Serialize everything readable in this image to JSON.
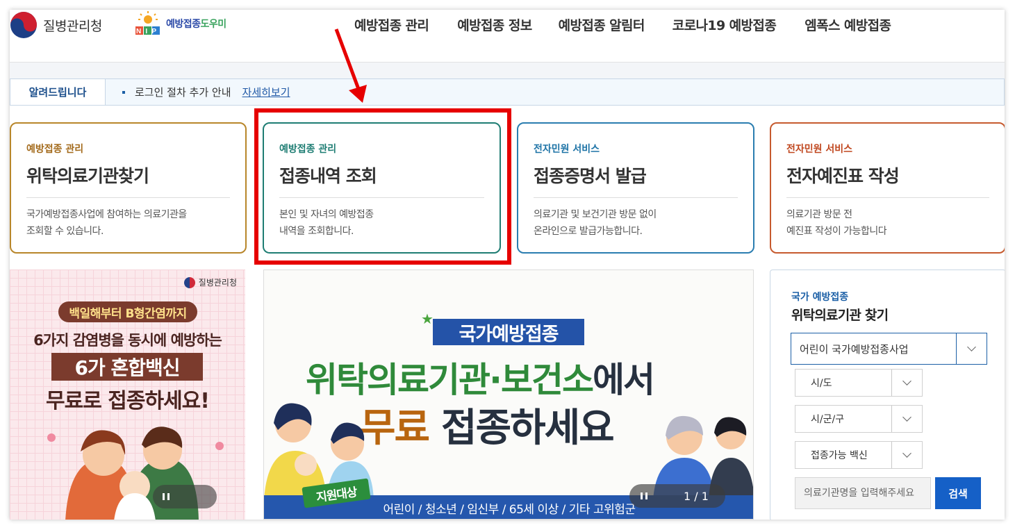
{
  "header": {
    "org_name": "질병관리청",
    "nip_name_part1": "예방접종",
    "nip_name_part2": "도우미",
    "nip_letters": "NIP",
    "nav": [
      "예방접종 관리",
      "예방접종 정보",
      "예방접종 알림터",
      "코로나19 예방접종",
      "엠폭스 예방접종"
    ]
  },
  "notice": {
    "label": "알려드립니다",
    "text": "로그인 절차 추가 안내",
    "link": "자세히보기"
  },
  "cards": [
    {
      "category": "예방접종 관리",
      "title": "위탁의료기관찾기",
      "desc": "국가예방접종사업에 참여하는 의료기관을\n조회할 수 있습니다."
    },
    {
      "category": "예방접종 관리",
      "title": "접종내역 조회",
      "desc": "본인 및 자녀의 예방접종\n내역을 조회합니다."
    },
    {
      "category": "전자민원 서비스",
      "title": "접종증명서 발급",
      "desc": "의료기관 및 보건기관 방문 없이\n온라인으로 발급가능합니다."
    },
    {
      "category": "전자민원 서비스",
      "title": "전자예진표 작성",
      "desc": "의료기관 방문 전\n예진표 작성이 가능합니다"
    }
  ],
  "banner_left": {
    "logo_text": "질병관리청",
    "pill": "백일해부터 B형간염까지",
    "line1": "6가지 감염병을 동시에 예방하는",
    "box": "6가 혼합백신",
    "line3": "무료로 접종하세요!"
  },
  "banner_center": {
    "tag": "국가예방접종",
    "headline1_green": "위탁의료기관·보건소",
    "headline1_dark": "에서",
    "headline2_orange": "무료",
    "headline2_dark": "접종하세요",
    "support": "지원대상",
    "bottom": "어린이 / 청소년 / 임신부 / 65세 이상 / 기타 고위험군",
    "counter": "1 / 1"
  },
  "search_panel": {
    "subtitle": "국가 예방접종",
    "title": "위탁의료기관 찾기",
    "program_select": "어린이 국가예방접종사업",
    "sido_select": "시/도",
    "sigungu_select": "시/군/구",
    "vaccine_select": "접종가능 백신",
    "input_placeholder": "의료기관명을 입력해주세요",
    "search_button": "검색"
  },
  "colors": {
    "highlight": "#e60000",
    "primary_blue": "#1560c7"
  }
}
